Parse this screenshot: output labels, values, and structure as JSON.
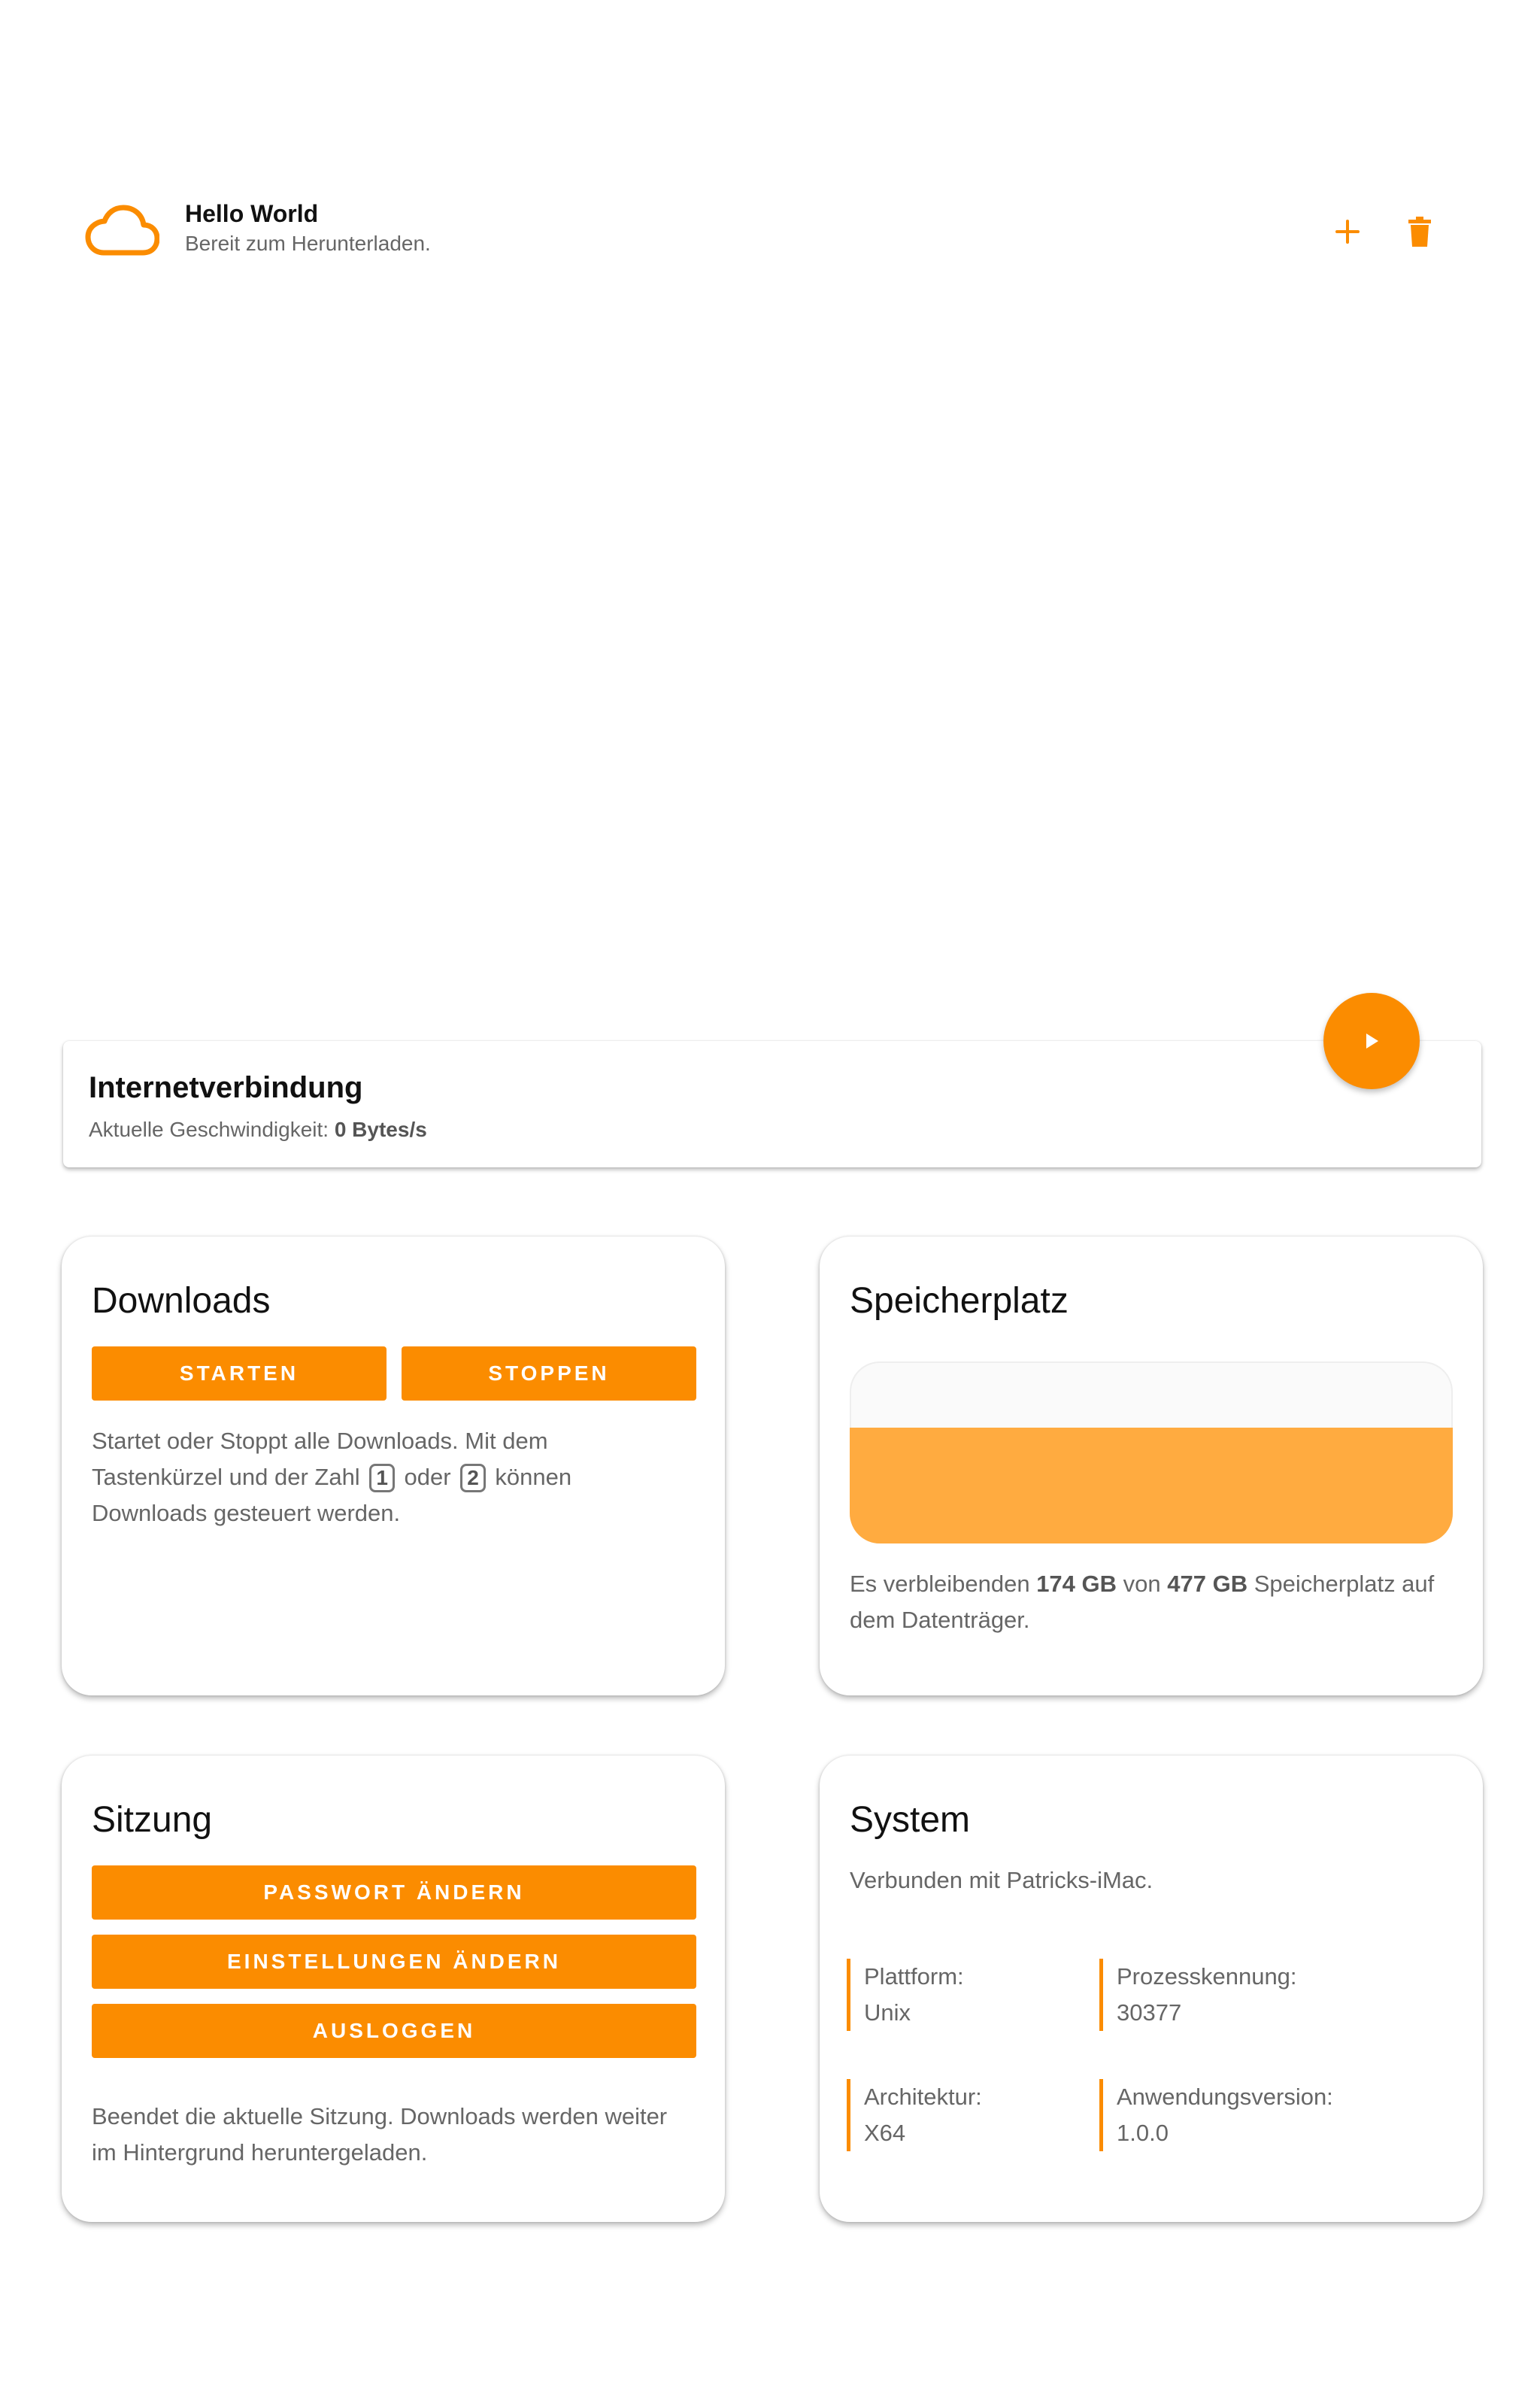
{
  "colors": {
    "accent": "#fb8c00",
    "bar_fill": "#ffab40"
  },
  "download_item": {
    "icon": "cloud-outline-icon",
    "title": "Hello World",
    "status": "Bereit zum Herunterladen.",
    "actions": [
      {
        "name": "add-icon",
        "label": "+"
      },
      {
        "name": "trash-icon",
        "label": ""
      }
    ]
  },
  "fab": {
    "icon": "play-icon"
  },
  "internet": {
    "title": "Internetverbindung",
    "speed_label": "Aktuelle Geschwindigkeit:",
    "speed_value": "0 Bytes/s"
  },
  "downloads": {
    "title": "Downloads",
    "start_label": "Starten",
    "stop_label": "Stoppen",
    "desc_1": "Startet oder Stoppt alle Downloads. Mit dem",
    "desc_2": "Tastenkürzel und der Zahl",
    "key_1": "1",
    "desc_3": "oder",
    "key_2": "2",
    "desc_4": "können",
    "desc_5": "Downloads gesteuert werden."
  },
  "storage": {
    "title": "Speicherplatz",
    "used_fraction": 0.635,
    "desc_1": "Es verbleibenden",
    "free": "174 GB",
    "desc_2": "von",
    "total": "477 GB",
    "desc_3": "Speicherplatz auf",
    "desc_4": "dem Datenträger."
  },
  "session": {
    "title": "Sitzung",
    "change_password_label": "Passwort ändern",
    "change_settings_label": "Einstellungen ändern",
    "logout_label": "Ausloggen",
    "desc_1": "Beendet die aktuelle Sitzung. Downloads werden weiter",
    "desc_2": "im Hintergrund heruntergeladen."
  },
  "system": {
    "title": "System",
    "connected": "Verbunden mit Patricks-iMac.",
    "fields": [
      {
        "label": "Plattform:",
        "value": "Unix"
      },
      {
        "label": "Prozesskennung:",
        "value": "30377"
      },
      {
        "label": "Architektur:",
        "value": "X64"
      },
      {
        "label": "Anwendungsversion:",
        "value": "1.0.0"
      }
    ]
  }
}
